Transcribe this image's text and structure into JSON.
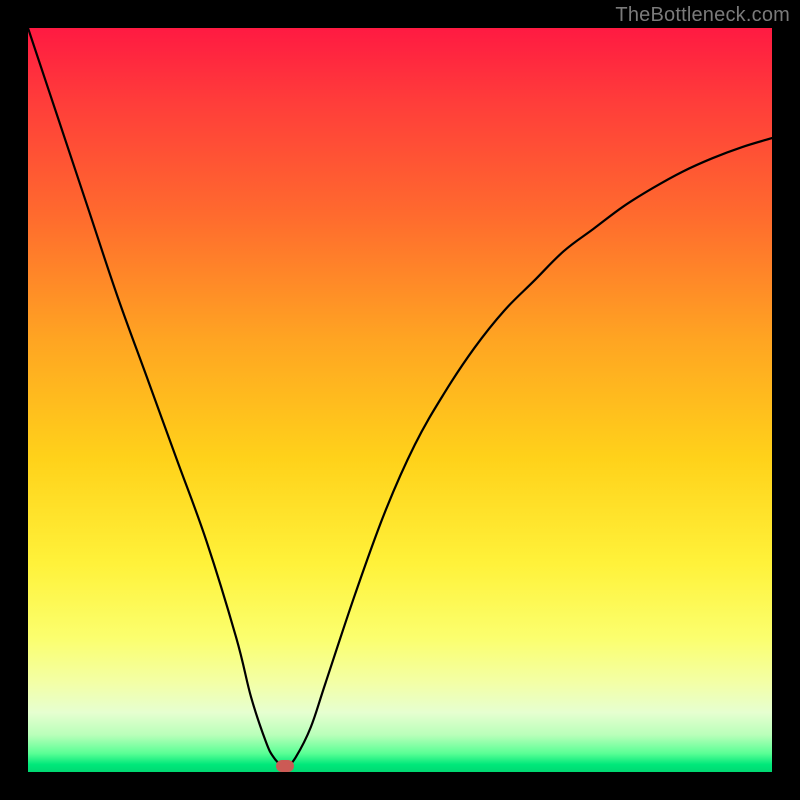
{
  "watermark": "TheBottleneck.com",
  "chart_data": {
    "type": "line",
    "title": "",
    "xlabel": "",
    "ylabel": "",
    "xlim": [
      0,
      100
    ],
    "ylim": [
      0,
      100
    ],
    "grid": false,
    "legend": false,
    "series": [
      {
        "name": "bottleneck-curve",
        "x": [
          0,
          4,
          8,
          12,
          16,
          20,
          24,
          28,
          30,
          32,
          33,
          34,
          35,
          36,
          38,
          40,
          44,
          48,
          52,
          56,
          60,
          64,
          68,
          72,
          76,
          80,
          84,
          88,
          92,
          96,
          100
        ],
        "values": [
          100,
          88,
          76,
          64,
          53,
          42,
          31,
          18,
          10,
          4,
          2,
          1,
          1,
          2,
          6,
          12,
          24,
          35,
          44,
          51,
          57,
          62,
          66,
          70,
          73,
          76,
          78.5,
          80.7,
          82.5,
          84,
          85.2
        ]
      }
    ],
    "marker": {
      "x": 34.5,
      "y": 0.8,
      "color": "#cc5a55"
    },
    "background_gradient": {
      "stops": [
        {
          "pos": 0,
          "color": "#ff1a42"
        },
        {
          "pos": 0.1,
          "color": "#ff3d3a"
        },
        {
          "pos": 0.25,
          "color": "#ff6a2e"
        },
        {
          "pos": 0.42,
          "color": "#ffa522"
        },
        {
          "pos": 0.58,
          "color": "#ffd21a"
        },
        {
          "pos": 0.72,
          "color": "#fff23a"
        },
        {
          "pos": 0.82,
          "color": "#fbff6e"
        },
        {
          "pos": 0.88,
          "color": "#f3ffa6"
        },
        {
          "pos": 0.92,
          "color": "#e6ffd0"
        },
        {
          "pos": 0.95,
          "color": "#baffba"
        },
        {
          "pos": 0.975,
          "color": "#5aff95"
        },
        {
          "pos": 0.99,
          "color": "#00e87a"
        },
        {
          "pos": 1.0,
          "color": "#00d872"
        }
      ]
    }
  }
}
